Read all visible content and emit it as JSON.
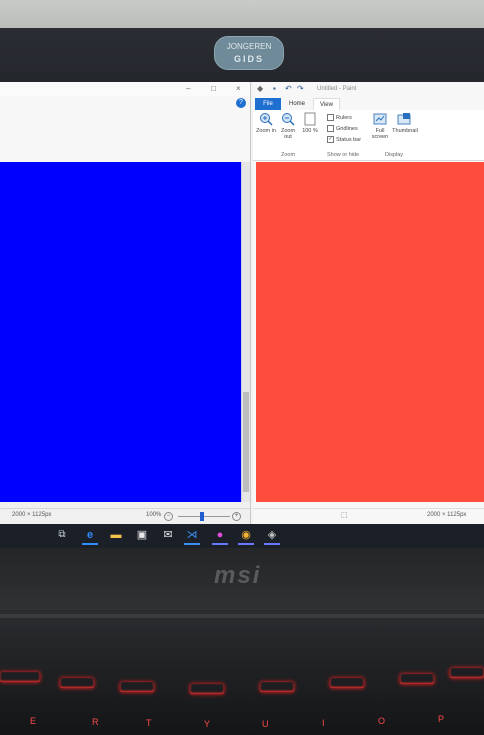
{
  "sticker": {
    "line1": "JONGEREN",
    "line2": "GIDS"
  },
  "left_window": {
    "controls": [
      "–",
      "□",
      "×"
    ],
    "help": "?",
    "canvas_color": "#0000fe",
    "status": {
      "size": "2000 × 1125px",
      "zoom": "100%",
      "zoom_out": "−",
      "zoom_in": "+"
    }
  },
  "right_window": {
    "title": "Untitled - Paint",
    "tabs": {
      "file": "File",
      "home": "Home",
      "view": "View"
    },
    "ribbon": {
      "zoom_in": "Zoom in",
      "zoom_out": "Zoom out",
      "zoom_100": "100 %",
      "rulers": "Rulers",
      "gridlines": "Gridlines",
      "status_bar": "Status bar",
      "full_screen": "Full screen",
      "thumbnail": "Thumbnail",
      "groups": {
        "zoom": "Zoom",
        "show_hide": "Show or hide",
        "display": "Display"
      }
    },
    "canvas_color": "#fe4d3c",
    "status": {
      "size": "2000 × 1125px"
    }
  },
  "laptop": {
    "logo": "msi"
  },
  "keys": [
    "E",
    "R",
    "T",
    "Y",
    "U",
    "I",
    "O",
    "P"
  ]
}
